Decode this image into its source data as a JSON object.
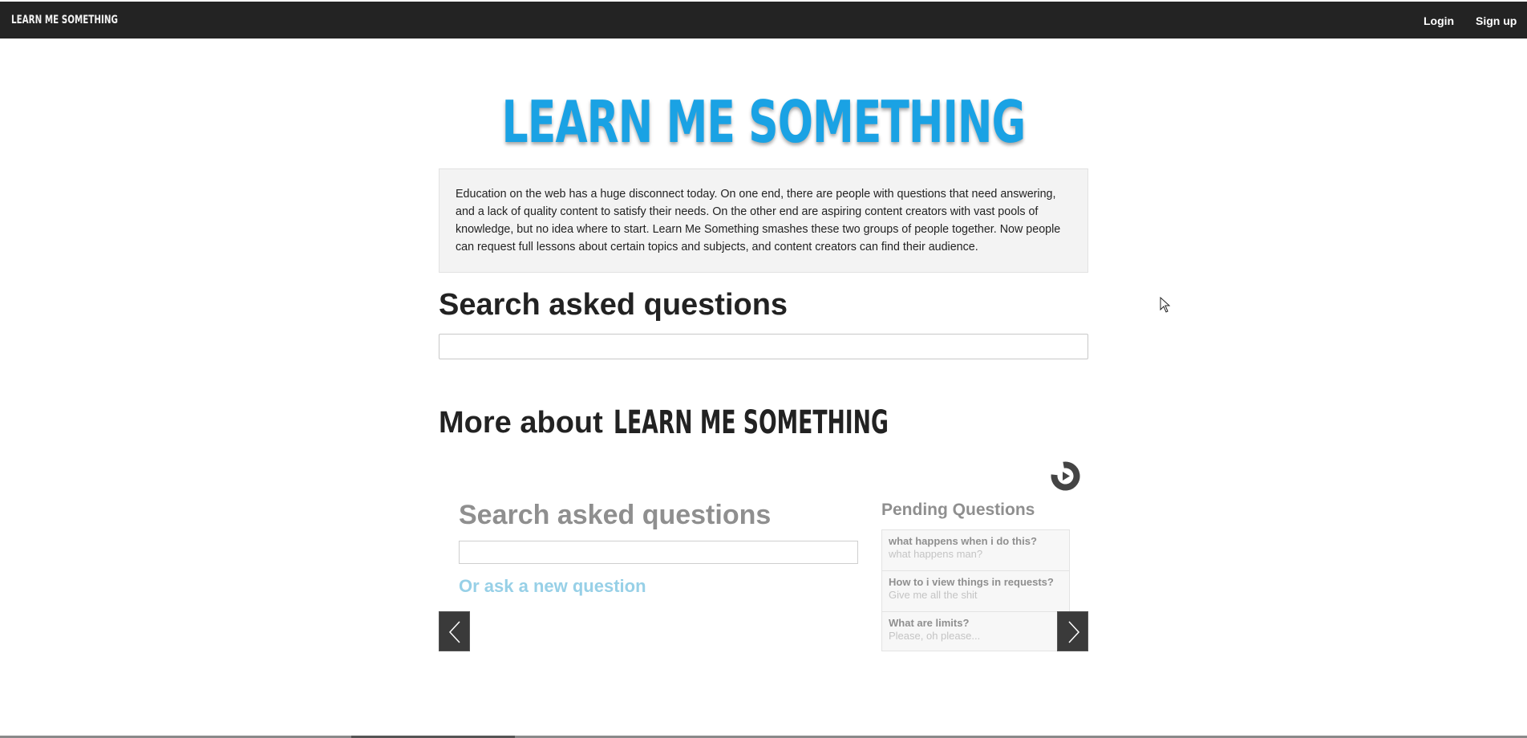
{
  "nav": {
    "brand": "LEARN ME SOMETHING",
    "login": "Login",
    "signup": "Sign up"
  },
  "hero": {
    "logo": "LEARN ME SOMETHING"
  },
  "intro": {
    "text": "Education on the web has a huge disconnect today. On one end, there are people with questions that need answering, and a lack of quality content to satisfy their needs. On the other end are aspiring content creators with vast pools of knowledge, but no idea where to start. Learn Me Something smashes these two groups of people together. Now people can request full lessons about certain topics and subjects, and content creators can find their audience."
  },
  "search": {
    "heading": "Search asked questions",
    "value": "",
    "placeholder": ""
  },
  "more": {
    "heading": "More about",
    "logo": "LEARN ME SOMETHING"
  },
  "slideshow": {
    "title": "Search asked questions",
    "new_question_link": "Or ask a new question",
    "pending_title": "Pending Questions",
    "pending": [
      {
        "question": "what happens when i do this?",
        "detail": "what happens man?"
      },
      {
        "question": "How to i view things in requests?",
        "detail": "Give me all the shit"
      },
      {
        "question": "What are limits?",
        "detail": "Please, oh please..."
      }
    ],
    "icons": {
      "prev": "chevron-left-icon",
      "next": "chevron-right-icon",
      "play": "play-icon"
    }
  },
  "colors": {
    "topbar": "#232323",
    "hero_logo": "#1aa2e4",
    "link": "#97d0e7"
  }
}
